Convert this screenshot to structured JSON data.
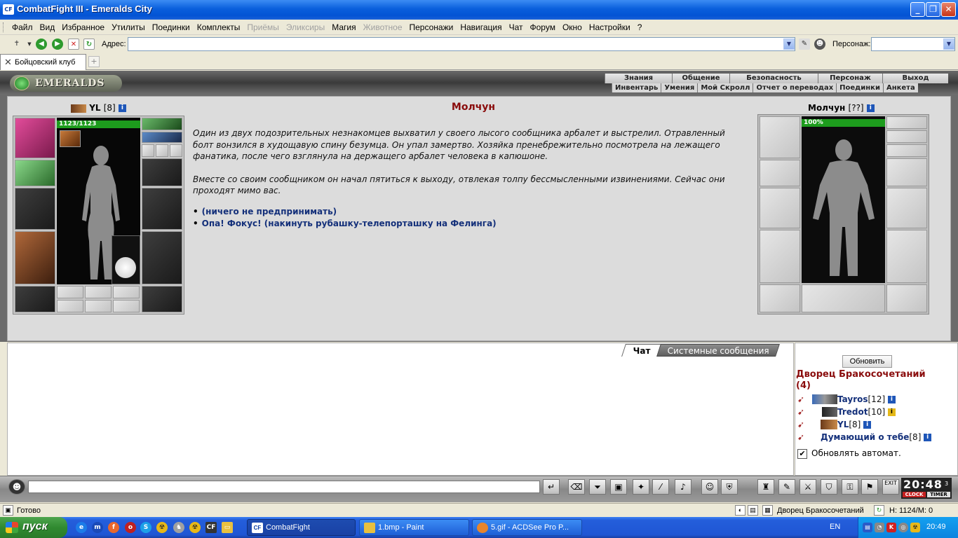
{
  "window": {
    "title": "CombatFight III - Emeralds City",
    "app_icon": "CF"
  },
  "menu": {
    "items": [
      {
        "label": "Файл",
        "disabled": false
      },
      {
        "label": "Вид",
        "disabled": false
      },
      {
        "label": "Избранное",
        "disabled": false
      },
      {
        "label": "Утилиты",
        "disabled": false
      },
      {
        "label": "Поединки",
        "disabled": false
      },
      {
        "label": "Комплекты",
        "disabled": false
      },
      {
        "label": "Приёмы",
        "disabled": true
      },
      {
        "label": "Эликсиры",
        "disabled": true
      },
      {
        "label": "Магия",
        "disabled": false
      },
      {
        "label": "Животное",
        "disabled": true
      },
      {
        "label": "Персонажи",
        "disabled": false
      },
      {
        "label": "Навигация",
        "disabled": false
      },
      {
        "label": "Чат",
        "disabled": false
      },
      {
        "label": "Форум",
        "disabled": false
      },
      {
        "label": "Окно",
        "disabled": false
      },
      {
        "label": "Настройки",
        "disabled": false
      },
      {
        "label": "?",
        "disabled": false
      }
    ]
  },
  "address_bar": {
    "label": "Адрес:",
    "value": "",
    "persona_label": "Персонаж:",
    "persona_value": ""
  },
  "tabs": {
    "items": [
      {
        "label": "Бойцовский клуб",
        "active": true
      }
    ]
  },
  "game_header": {
    "logo_text": "EMERALDS",
    "top_nav": [
      "Знания",
      "Общение",
      "Безопасность",
      "Персонаж",
      "Выход"
    ],
    "sub_nav": [
      "Инвентарь",
      "Умения",
      "Мой Скролл",
      "Отчет о переводах",
      "Поединки",
      "Анкета"
    ]
  },
  "player": {
    "name": "YL",
    "level": "[8]",
    "hp_text": "1123/1123",
    "hp_fraction": 1.0
  },
  "opponent": {
    "name": "Молчун",
    "level": "[??]",
    "hp_text": "100%",
    "hp_fraction": 1.0
  },
  "story": {
    "title": "Молчун",
    "paragraphs": [
      "Один из двух подозрительных незнакомцев выхватил у своего лысого сообщника арбалет и выстрелил. Отравленный болт вонзился в худощавую спину безумца. Он упал замертво. Хозяйка пренебрежительно посмотрела на лежащего фанатика, после чего взглянула на держащего арбалет человека в капюшоне.",
      "Вместе со своим сообщником он начал пятиться к выходу, отвлекая толпу бессмысленными извинениями. Сейчас они проходят мимо вас."
    ],
    "choices": [
      "(ничего не предпринимать)",
      "Опа! Фокус! (накинуть рубашку-телепорташку на Фелинга)"
    ]
  },
  "chat": {
    "tab_chat": "Чат",
    "tab_system": "Системные сообщения",
    "input_value": ""
  },
  "room": {
    "refresh_label": "Обновить",
    "title": "Дворец Бракосочетаний",
    "count": "(4)",
    "members": [
      {
        "name": "Tayros",
        "level": "[12]",
        "info": "blue"
      },
      {
        "name": "Tredot",
        "level": "[10]",
        "info": "yellow"
      },
      {
        "name": "YL",
        "level": "[8]",
        "info": "blue"
      },
      {
        "name": "Думающий о тебе",
        "level": "[8]",
        "info": "blue"
      }
    ],
    "auto_refresh_label": "Обновлять автомат.",
    "auto_refresh_checked": true
  },
  "clock": {
    "time": "20:48",
    "seconds": "3",
    "clock_label": "CLOCK",
    "timer_label": "TIMER"
  },
  "statusbar": {
    "text": "Готово",
    "location": "Дворец Бракосочетаний",
    "hp_info": "H: 1124/M: 0"
  },
  "taskbar": {
    "start_label": "пуск",
    "items": [
      {
        "label": "CombatFight",
        "icon": "CF",
        "active": true
      },
      {
        "label": "1.bmp - Paint",
        "icon": "paint-icon",
        "active": false
      },
      {
        "label": "5.gif - ACDSee Pro P...",
        "icon": "acdsee-icon",
        "active": false
      }
    ],
    "language": "EN",
    "time": "20:49"
  }
}
